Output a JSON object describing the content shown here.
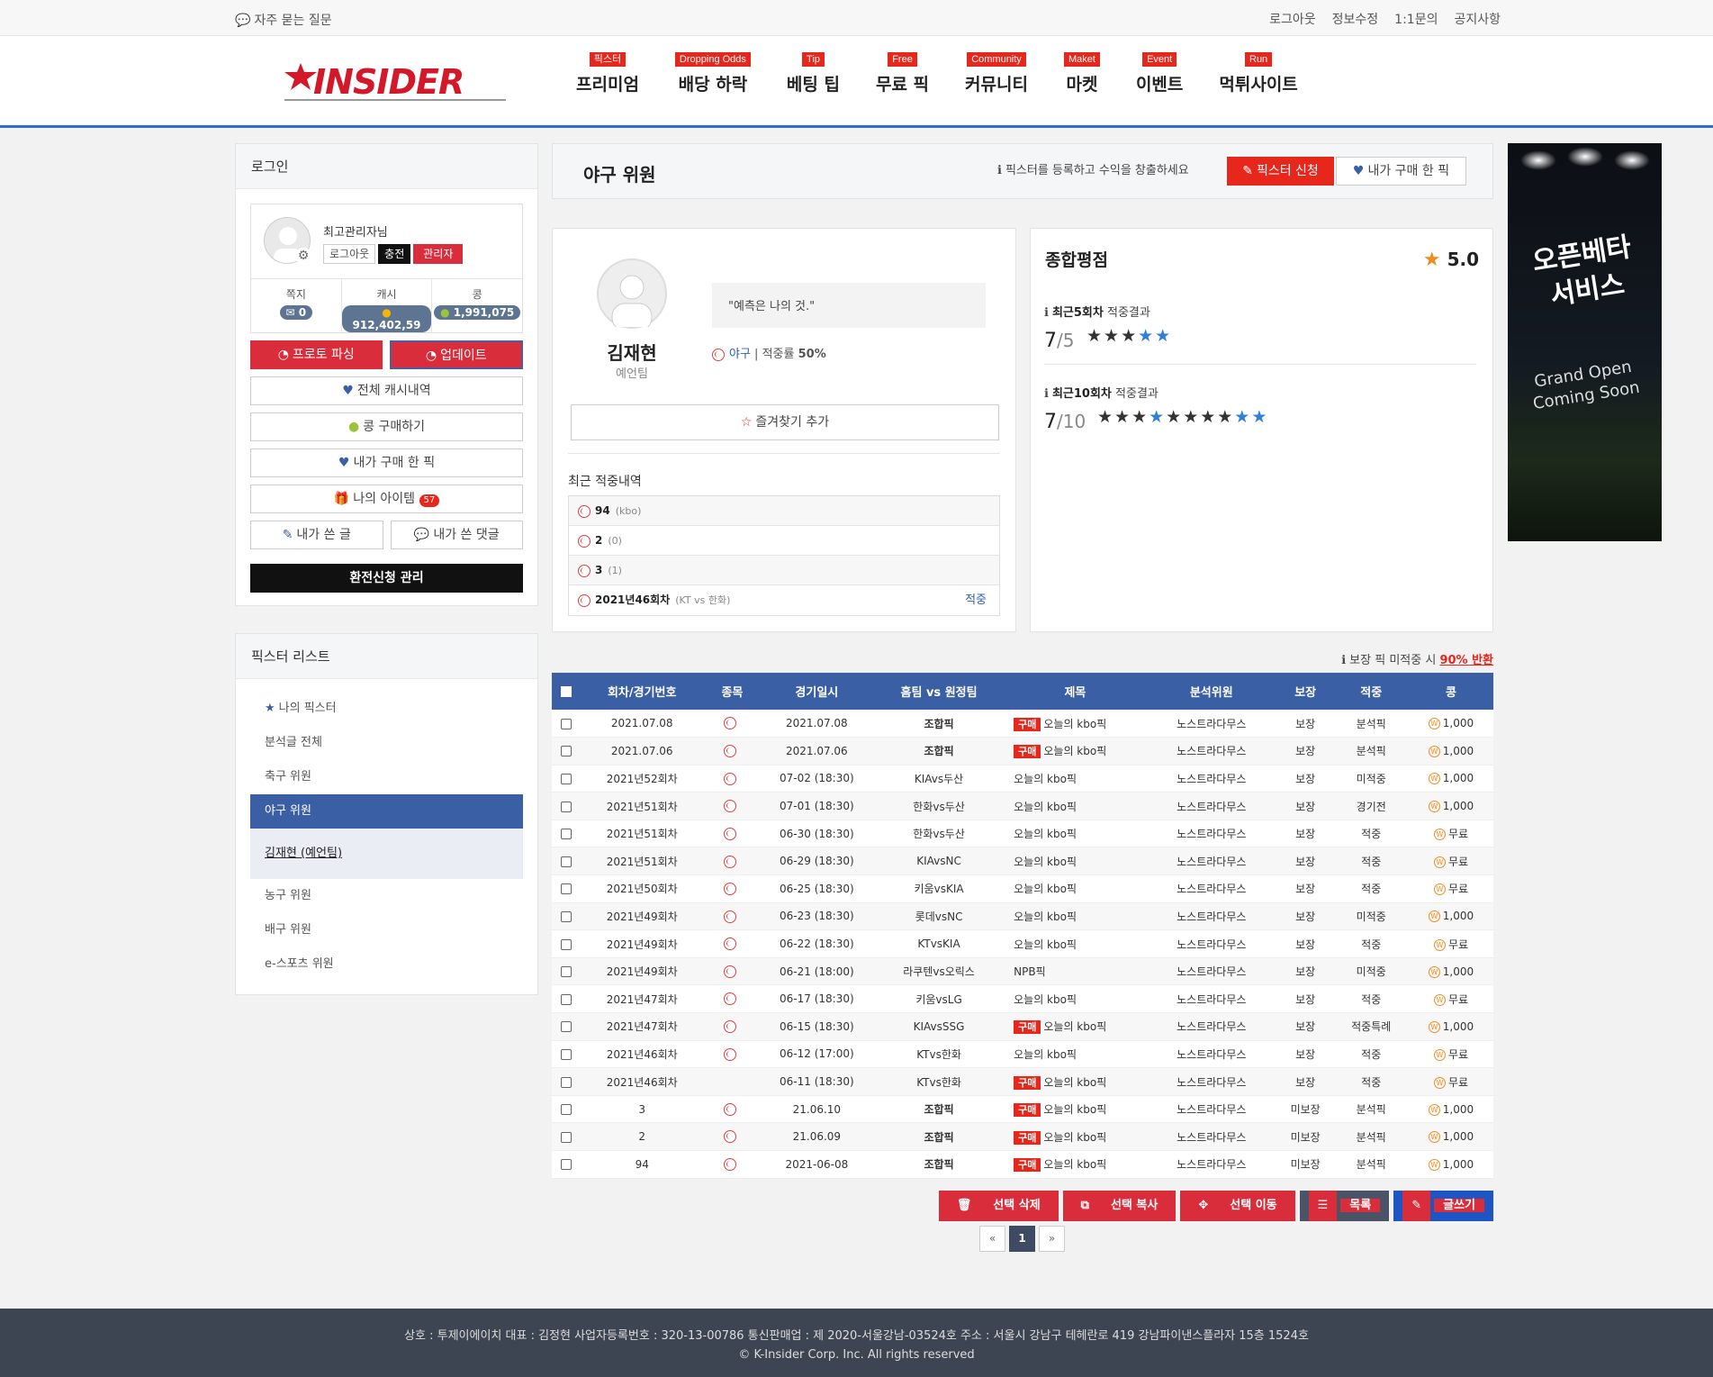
{
  "topbar": {
    "faq": "자주 묻는 질문",
    "links": [
      "로그아웃",
      "정보수정",
      "1:1문의",
      "공지사항"
    ]
  },
  "logo": {
    "text": "K INSIDER"
  },
  "nav": [
    {
      "tag": "픽스터",
      "label": "프리미엄"
    },
    {
      "tag": "Dropping Odds",
      "label": "배당 하락"
    },
    {
      "tag": "Tip",
      "label": "베팅 팁"
    },
    {
      "tag": "Free",
      "label": "무료 픽"
    },
    {
      "tag": "Community",
      "label": "커뮤니티"
    },
    {
      "tag": "Maket",
      "label": "마켓"
    },
    {
      "tag": "Event",
      "label": "이벤트"
    },
    {
      "tag": "Run",
      "label": "먹튀사이트"
    }
  ],
  "login": {
    "title": "로그인",
    "username": "최고관리자님",
    "btn_logout": "로그아웃",
    "btn_charge": "충전",
    "btn_admin": "관리자",
    "stats": [
      {
        "label": "쪽지",
        "value": "0"
      },
      {
        "label": "캐시",
        "value": "912,402,59"
      },
      {
        "label": "콩",
        "value": "1,991,075"
      }
    ],
    "btn_proto": "프로토 파싱",
    "btn_update": "업데이트",
    "btn_cash": "전체 캐시내역",
    "btn_kong": "콩 구매하기",
    "btn_mypicks": "내가 구매 한 픽",
    "btn_items": "나의 아이템",
    "items_count": "57",
    "btn_posts": "내가 쓴 글",
    "btn_comments": "내가 쓴 댓글",
    "btn_exchange": "환전신청 관리"
  },
  "pickster_list": {
    "title": "픽스터 리스트",
    "items": [
      "나의 픽스터",
      "분석글 전체",
      "축구 위원",
      "야구 위원",
      "김재현 (예언팀)",
      "농구 위원",
      "배구 위원",
      "e-스포츠 위원"
    ]
  },
  "main": {
    "title": "야구 위원",
    "hint": "픽스터를 등록하고 수익을 창출하세요",
    "btn_apply": "픽스터 신청",
    "btn_mypicks": "내가 구매 한 픽"
  },
  "profile": {
    "name": "김재현",
    "team": "예언팀",
    "quote": "\"예측은 나의 것.\"",
    "sport": "야구",
    "rate_label": "적중률",
    "rate_value": "50%",
    "fav_btn": "즐겨찾기 추가",
    "recent_title": "최근 적중내역",
    "recent": [
      {
        "title": "94",
        "sub": "(kbo)",
        "result": ""
      },
      {
        "title": "2",
        "sub": "(0)",
        "result": ""
      },
      {
        "title": "3",
        "sub": "(1)",
        "result": ""
      },
      {
        "title": "2021년46회차",
        "sub": "(KT vs 한화)",
        "result": "적중"
      }
    ]
  },
  "rating": {
    "title": "종합평점",
    "score": "5.0",
    "recent5_label": "최근5회차",
    "recent5_suffix": "적중결과",
    "recent5_hit": "7",
    "recent5_total": "/5",
    "recent10_label": "최근10회차",
    "recent10_suffix": "적중결과",
    "recent10_hit": "7",
    "recent10_total": "/10"
  },
  "guarantee": {
    "text": "보장 픽 미적중 시",
    "highlight": "90% 반환"
  },
  "table": {
    "headers": [
      "회차/경기번호",
      "종목",
      "경기일시",
      "홈팀 vs 원정팀",
      "제목",
      "분석위원",
      "보장",
      "적중",
      "콩"
    ],
    "rows": [
      {
        "round": "2021.07.08",
        "date": "2021.07.08",
        "teams": "조합픽",
        "buy": true,
        "title": "오늘의 kbo픽",
        "analyst": "노스트라다무스",
        "guarantee": "보장",
        "result": "분석픽",
        "price": "1,000",
        "ball": true
      },
      {
        "round": "2021.07.06",
        "date": "2021.07.06",
        "teams": "조합픽",
        "buy": true,
        "title": "오늘의 kbo픽",
        "analyst": "노스트라다무스",
        "guarantee": "보장",
        "result": "분석픽",
        "price": "1,000",
        "ball": true
      },
      {
        "round": "2021년52회차",
        "date": "07-02 (18:30)",
        "teams": "KIAvs두산",
        "buy": false,
        "title": "오늘의 kbo픽",
        "analyst": "노스트라다무스",
        "guarantee": "보장",
        "result": "미적중",
        "price": "1,000",
        "ball": true
      },
      {
        "round": "2021년51회차",
        "date": "07-01 (18:30)",
        "teams": "한화vs두산",
        "buy": false,
        "title": "오늘의 kbo픽",
        "analyst": "노스트라다무스",
        "guarantee": "보장",
        "result": "경기전",
        "price": "1,000",
        "ball": true
      },
      {
        "round": "2021년51회차",
        "date": "06-30 (18:30)",
        "teams": "한화vs두산",
        "buy": false,
        "title": "오늘의 kbo픽",
        "analyst": "노스트라다무스",
        "guarantee": "보장",
        "result": "적중",
        "price": "무료",
        "ball": true
      },
      {
        "round": "2021년51회차",
        "date": "06-29 (18:30)",
        "teams": "KIAvsNC",
        "buy": false,
        "title": "오늘의 kbo픽",
        "analyst": "노스트라다무스",
        "guarantee": "보장",
        "result": "적중",
        "price": "무료",
        "ball": true
      },
      {
        "round": "2021년50회차",
        "date": "06-25 (18:30)",
        "teams": "키움vsKIA",
        "buy": false,
        "title": "오늘의 kbo픽",
        "analyst": "노스트라다무스",
        "guarantee": "보장",
        "result": "적중",
        "price": "무료",
        "ball": true
      },
      {
        "round": "2021년49회차",
        "date": "06-23 (18:30)",
        "teams": "롯데vsNC",
        "buy": false,
        "title": "오늘의 kbo픽",
        "analyst": "노스트라다무스",
        "guarantee": "보장",
        "result": "미적중",
        "price": "1,000",
        "ball": true
      },
      {
        "round": "2021년49회차",
        "date": "06-22 (18:30)",
        "teams": "KTvsKIA",
        "buy": false,
        "title": "오늘의 kbo픽",
        "analyst": "노스트라다무스",
        "guarantee": "보장",
        "result": "적중",
        "price": "무료",
        "ball": true
      },
      {
        "round": "2021년49회차",
        "date": "06-21 (18:00)",
        "teams": "라쿠텐vs오릭스",
        "buy": false,
        "title": "NPB픽",
        "analyst": "노스트라다무스",
        "guarantee": "보장",
        "result": "미적중",
        "price": "1,000",
        "ball": true
      },
      {
        "round": "2021년47회차",
        "date": "06-17 (18:30)",
        "teams": "키움vsLG",
        "buy": false,
        "title": "오늘의 kbo픽",
        "analyst": "노스트라다무스",
        "guarantee": "보장",
        "result": "적중",
        "price": "무료",
        "ball": true
      },
      {
        "round": "2021년47회차",
        "date": "06-15 (18:30)",
        "teams": "KIAvsSSG",
        "buy": true,
        "title": "오늘의 kbo픽",
        "analyst": "노스트라다무스",
        "guarantee": "보장",
        "result": "적중특례",
        "price": "1,000",
        "ball": true
      },
      {
        "round": "2021년46회차",
        "date": "06-12 (17:00)",
        "teams": "KTvs한화",
        "buy": false,
        "title": "오늘의 kbo픽",
        "analyst": "노스트라다무스",
        "guarantee": "보장",
        "result": "적중",
        "price": "무료",
        "ball": true
      },
      {
        "round": "2021년46회차",
        "date": "06-11 (18:30)",
        "teams": "KTvs한화",
        "buy": true,
        "title": "오늘의 kbo픽",
        "analyst": "노스트라다무스",
        "guarantee": "보장",
        "result": "적중",
        "price": "무료",
        "ball": false
      },
      {
        "round": "3",
        "date": "21.06.10",
        "teams": "조합픽",
        "buy": true,
        "title": "오늘의 kbo픽",
        "analyst": "노스트라다무스",
        "guarantee": "미보장",
        "result": "분석픽",
        "price": "1,000",
        "ball": true
      },
      {
        "round": "2",
        "date": "21.06.09",
        "teams": "조합픽",
        "buy": true,
        "title": "오늘의 kbo픽",
        "analyst": "노스트라다무스",
        "guarantee": "미보장",
        "result": "분석픽",
        "price": "1,000",
        "ball": true
      },
      {
        "round": "94",
        "date": "2021-06-08",
        "teams": "조합픽",
        "buy": true,
        "title": "오늘의 kbo픽",
        "analyst": "노스트라다무스",
        "guarantee": "미보장",
        "result": "분석픽",
        "price": "1,000",
        "ball": true
      }
    ],
    "buy_label": "구매"
  },
  "actions": [
    "선택 삭제",
    "선택 복사",
    "선택 이동",
    "목록",
    "글쓰기"
  ],
  "pager": {
    "first": "«",
    "current": "1",
    "last": "»"
  },
  "banner": {
    "title1": "오픈베타",
    "title2": "서비스",
    "sub1": "Grand Open",
    "sub2": "Coming Soon"
  },
  "footer": {
    "line1": "상호 : 투제이에이치 대표 : 김정현 사업자등록번호 : 320-13-00786 통신판매업 : 제 2020-서울강남-03524호 주소 : 서울시 강남구 테헤란로 419 강남파이낸스플라자 15층 1524호",
    "line2": "© K-Insider Corp. Inc. All rights reserved"
  },
  "colors": {
    "accent": "#3b5fa5",
    "red": "#e8271c",
    "header_border": "#2c6fd3"
  }
}
